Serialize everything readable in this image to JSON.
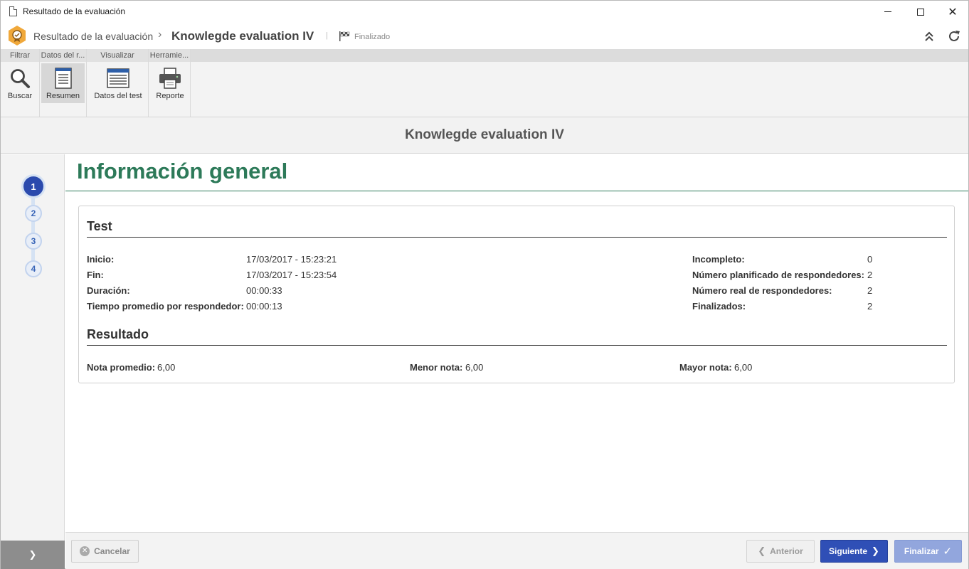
{
  "window": {
    "title": "Resultado de la evaluación"
  },
  "breadcrumb": {
    "parent": "Resultado de la evaluación",
    "separator": "›",
    "current": "Knowlegde evaluation IV",
    "divider": "|",
    "status": "Finalizado"
  },
  "ribbon": {
    "groups": [
      {
        "label": "Filtrar"
      },
      {
        "label": "Datos del r..."
      },
      {
        "label": "Visualizar"
      },
      {
        "label": "Herramie..."
      }
    ],
    "buttons": {
      "buscar": "Buscar",
      "resumen": "Resumen",
      "datos_test": "Datos del test",
      "reporte": "Reporte"
    }
  },
  "page": {
    "header": "Knowlegde evaluation IV",
    "section_title": "Información general"
  },
  "steps": [
    "1",
    "2",
    "3",
    "4"
  ],
  "test": {
    "heading": "Test",
    "left": [
      {
        "label": "Inicio:",
        "value": "17/03/2017 - 15:23:21"
      },
      {
        "label": "Fin:",
        "value": "17/03/2017 - 15:23:54"
      },
      {
        "label": "Duración:",
        "value": "00:00:33"
      },
      {
        "label": "Tiempo promedio por respondedor:",
        "value": "00:00:13"
      }
    ],
    "right": [
      {
        "label": "Incompleto:",
        "value": "0"
      },
      {
        "label": "Número planificado de respondedores:",
        "value": "2"
      },
      {
        "label": "Número real de respondedores:",
        "value": "2"
      },
      {
        "label": "Finalizados:",
        "value": "2"
      }
    ]
  },
  "resultado": {
    "heading": "Resultado",
    "items": [
      {
        "label": "Nota promedio:",
        "value": "6,00"
      },
      {
        "label": "Menor nota:",
        "value": "6,00"
      },
      {
        "label": "Mayor nota:",
        "value": "6,00"
      }
    ]
  },
  "footer": {
    "cancel": "Cancelar",
    "previous": "Anterior",
    "next": "Siguiente",
    "finish": "Finalizar"
  },
  "colors": {
    "section_green": "#2d7a59",
    "primary_blue": "#2f4fb6",
    "app_logo_orange": "#f0a83a"
  },
  "icons": {
    "document": "document-icon",
    "app": "app-logo-icon",
    "flag": "checkered-flag-icon",
    "collapse": "collapse-up-icon",
    "refresh": "refresh-icon",
    "search": "search-icon",
    "summary": "summary-doc-icon",
    "test_data": "table-window-icon",
    "printer": "printer-icon"
  }
}
